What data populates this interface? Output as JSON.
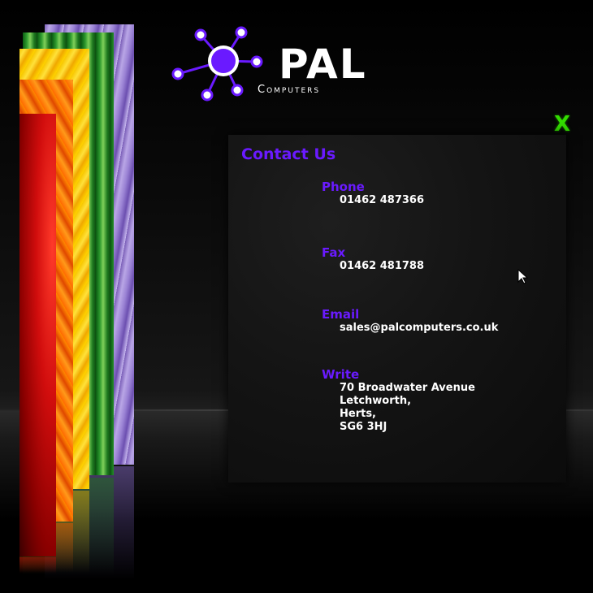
{
  "logo": {
    "name": "PAL",
    "subtitle": "Computers"
  },
  "close_label": "X",
  "contact": {
    "title": "Contact Us",
    "phone": {
      "label": "Phone",
      "value": "01462 487366"
    },
    "fax": {
      "label": "Fax",
      "value": "01462 481788"
    },
    "email": {
      "label": "Email",
      "value": "sales@palcomputers.co.uk"
    },
    "write": {
      "label": "Write",
      "lines": [
        "70 Broadwater Avenue",
        "Letchworth,",
        "Herts,",
        "SG6 3HJ"
      ]
    }
  },
  "colors": {
    "accent_purple": "#6a1aff",
    "close_green": "#33dd00",
    "text_white": "#ffffff"
  },
  "icons": [
    "pal-network-logo-icon",
    "close-icon",
    "mouse-cursor-icon"
  ]
}
